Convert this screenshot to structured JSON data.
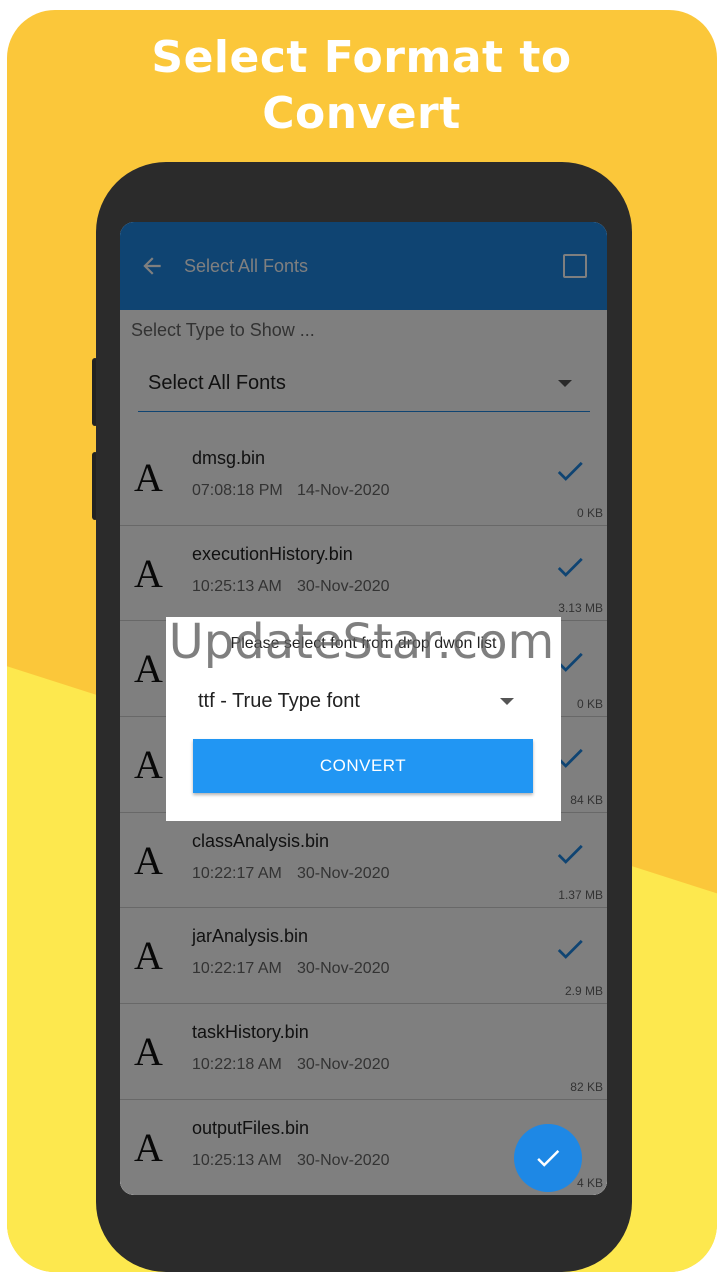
{
  "promo": {
    "headline_line1": "Select Format to",
    "headline_line2": "Convert",
    "colors": {
      "top": "#fbc73a",
      "bottom": "#fde84e"
    }
  },
  "appbar": {
    "title": "Select All Fonts",
    "back_icon": "arrow-left-icon",
    "select_all_icon": "checkbox-icon",
    "color": "#1e88e5"
  },
  "filter": {
    "label": "Select Type to Show ...",
    "selected": "Select All Fonts"
  },
  "files": [
    {
      "name": "dmsg.bin",
      "time": "07:08:18 PM",
      "date": "14-Nov-2020",
      "size": "0 KB",
      "checked": true
    },
    {
      "name": "executionHistory.bin",
      "time": "10:25:13 AM",
      "date": "30-Nov-2020",
      "size": "3.13 MB",
      "checked": true
    },
    {
      "name": "",
      "time": "",
      "date": "",
      "size": "0 KB",
      "checked": true
    },
    {
      "name": "",
      "time": "",
      "date": "",
      "size": "84 KB",
      "checked": true
    },
    {
      "name": "classAnalysis.bin",
      "time": "10:22:17 AM",
      "date": "30-Nov-2020",
      "size": "1.37 MB",
      "checked": true
    },
    {
      "name": "jarAnalysis.bin",
      "time": "10:22:17 AM",
      "date": "30-Nov-2020",
      "size": "2.9 MB",
      "checked": true
    },
    {
      "name": "taskHistory.bin",
      "time": "10:22:18 AM",
      "date": "30-Nov-2020",
      "size": "82 KB",
      "checked": false
    },
    {
      "name": "outputFiles.bin",
      "time": "10:25:13 AM",
      "date": "30-Nov-2020",
      "size": "4 KB",
      "checked": false
    }
  ],
  "file_glyph": "A",
  "dialog": {
    "message": "Please select font from drop dwon list",
    "selected_format": "ttf - True Type font",
    "convert_label": "CONVERT"
  },
  "fab_icon": "check-icon",
  "watermark": "UpdateStar.com"
}
